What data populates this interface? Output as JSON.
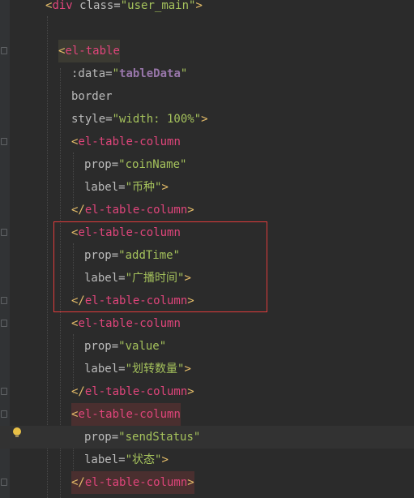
{
  "editor": {
    "lines": [
      {
        "parts": [
          {
            "t": "<",
            "c": "t-punct"
          },
          {
            "t": "div",
            "c": "t-tag"
          },
          {
            "t": " class=",
            "c": "t-attr"
          },
          {
            "t": "\"user_main\"",
            "c": "t-str"
          },
          {
            "t": ">",
            "c": "t-punct"
          }
        ]
      },
      {
        "parts": []
      },
      {
        "parts": [
          {
            "t": "<",
            "c": "t-punct"
          },
          {
            "t": "el-table",
            "c": "t-tag"
          }
        ],
        "hl": "hl-tag"
      },
      {
        "parts": [
          {
            "t": ":data=",
            "c": "t-attr"
          },
          {
            "t": "\"",
            "c": "t-str"
          },
          {
            "t": "tableData",
            "c": "t-code"
          },
          {
            "t": "\"",
            "c": "t-str"
          }
        ]
      },
      {
        "parts": [
          {
            "t": "border",
            "c": "t-attr"
          }
        ]
      },
      {
        "parts": [
          {
            "t": "style=",
            "c": "t-attr"
          },
          {
            "t": "\"width: 100%\"",
            "c": "t-str"
          },
          {
            "t": ">",
            "c": "t-punct"
          }
        ]
      },
      {
        "parts": [
          {
            "t": "<",
            "c": "t-punct"
          },
          {
            "t": "el-table-column",
            "c": "t-tag"
          }
        ]
      },
      {
        "parts": [
          {
            "t": "prop=",
            "c": "t-attr"
          },
          {
            "t": "\"coinName\"",
            "c": "t-str"
          }
        ]
      },
      {
        "parts": [
          {
            "t": "label=",
            "c": "t-attr"
          },
          {
            "t": "\"币种\"",
            "c": "t-str"
          },
          {
            "t": ">",
            "c": "t-punct"
          }
        ]
      },
      {
        "parts": [
          {
            "t": "</",
            "c": "t-punct"
          },
          {
            "t": "el-table-column",
            "c": "t-tag"
          },
          {
            "t": ">",
            "c": "t-punct"
          }
        ]
      },
      {
        "parts": [
          {
            "t": "<",
            "c": "t-punct"
          },
          {
            "t": "el-table-column",
            "c": "t-tag"
          }
        ]
      },
      {
        "parts": [
          {
            "t": "prop=",
            "c": "t-attr"
          },
          {
            "t": "\"addTime\"",
            "c": "t-str"
          }
        ]
      },
      {
        "parts": [
          {
            "t": "label=",
            "c": "t-attr"
          },
          {
            "t": "\"广播时间\"",
            "c": "t-str"
          },
          {
            "t": ">",
            "c": "t-punct"
          }
        ]
      },
      {
        "parts": [
          {
            "t": "</",
            "c": "t-punct"
          },
          {
            "t": "el-table-column",
            "c": "t-tag"
          },
          {
            "t": ">",
            "c": "t-punct"
          }
        ]
      },
      {
        "parts": [
          {
            "t": "<",
            "c": "t-punct"
          },
          {
            "t": "el-table-column",
            "c": "t-tag"
          }
        ]
      },
      {
        "parts": [
          {
            "t": "prop=",
            "c": "t-attr"
          },
          {
            "t": "\"value\"",
            "c": "t-str"
          }
        ]
      },
      {
        "parts": [
          {
            "t": "label=",
            "c": "t-attr"
          },
          {
            "t": "\"划转数量\"",
            "c": "t-str"
          },
          {
            "t": ">",
            "c": "t-punct"
          }
        ]
      },
      {
        "parts": [
          {
            "t": "</",
            "c": "t-punct"
          },
          {
            "t": "el-table-column",
            "c": "t-tag"
          },
          {
            "t": ">",
            "c": "t-punct"
          }
        ]
      },
      {
        "parts": [
          {
            "t": "<",
            "c": "t-punct"
          },
          {
            "t": "el-table-column",
            "c": "t-tag"
          }
        ],
        "hl": "hl-close"
      },
      {
        "parts": [
          {
            "t": "prop=",
            "c": "t-attr"
          },
          {
            "t": "\"sendStatus\"",
            "c": "t-str"
          }
        ],
        "current": true
      },
      {
        "parts": [
          {
            "t": "label=",
            "c": "t-attr"
          },
          {
            "t": "\"状态\"",
            "c": "t-str"
          },
          {
            "t": ">",
            "c": "t-punct"
          }
        ]
      },
      {
        "parts": [
          {
            "t": "</",
            "c": "t-punct"
          },
          {
            "t": "el-table-column",
            "c": "t-tag"
          },
          {
            "t": ">",
            "c": "t-punct"
          }
        ],
        "hl": "hl-close"
      }
    ]
  }
}
